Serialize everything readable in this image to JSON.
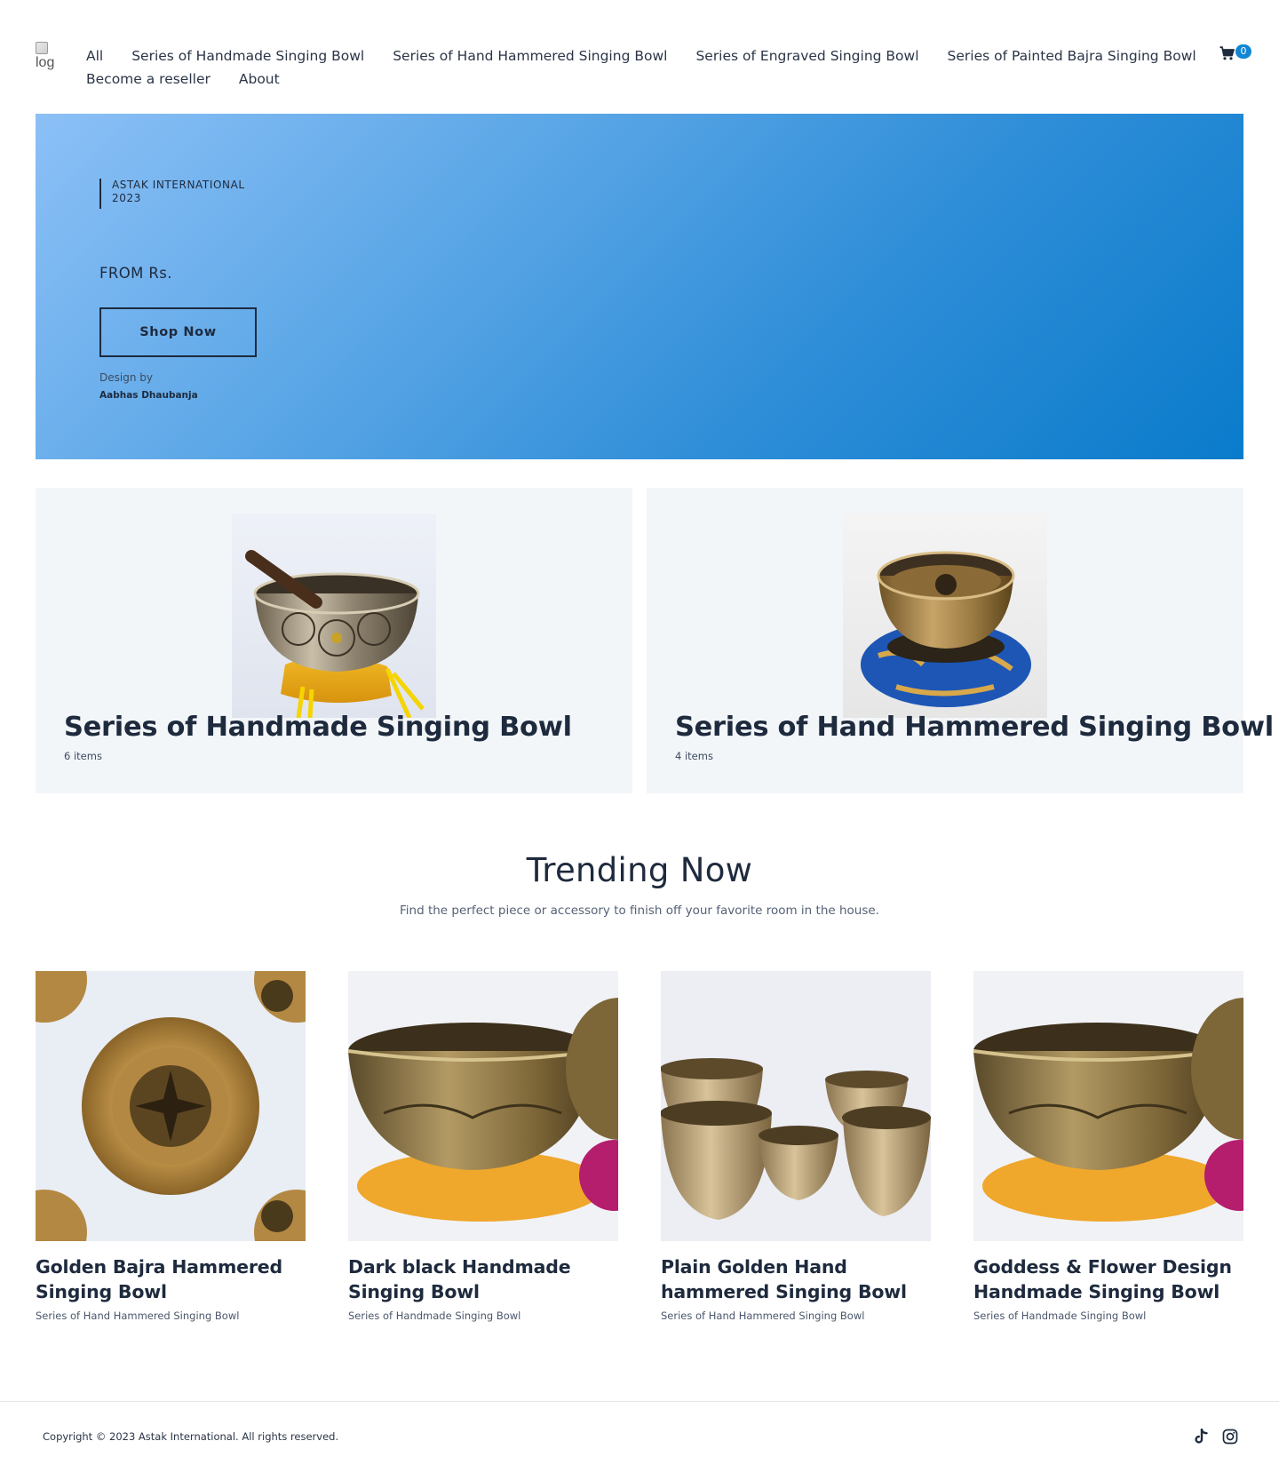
{
  "header": {
    "logo_alt": "log",
    "nav_row1": [
      "All",
      "Series of Handmade Singing Bowl",
      "Series of Hand Hammered Singing Bowl",
      "Series of Engraved Singing Bowl",
      "Series of Painted Bajra Singing Bowl"
    ],
    "nav_row2": [
      "Become a reseller",
      "About"
    ],
    "cart": {
      "icon": "cart-icon",
      "count": "0",
      "badge_color": "#1186d4"
    }
  },
  "hero": {
    "brand_line1": "ASTAK INTERNATIONAL",
    "brand_line2": "2023",
    "price_label": "FROM Rs.",
    "cta_label": "Shop Now",
    "design_by_label": "Design by",
    "designer_name": "Aabhas Dhaubanja",
    "gradient_start": "#8cc0f7",
    "gradient_end": "#0a7bcb"
  },
  "collections": [
    {
      "title": "Series of Handmade Singing Bowl",
      "count": "6 items"
    },
    {
      "title": "Series of Hand Hammered Singing Bowl",
      "count": "4 items"
    }
  ],
  "trending": {
    "title": "Trending Now",
    "subtitle": "Find the perfect piece or accessory to finish off your favorite room in the house.",
    "products": [
      {
        "name": "Golden Bajra Hammered Singing Bowl",
        "series": "Series of Hand Hammered Singing Bowl"
      },
      {
        "name": "Dark black Handmade Singing Bowl",
        "series": "Series of Handmade Singing Bowl"
      },
      {
        "name": "Plain Golden Hand hammered Singing Bowl",
        "series": "Series of Hand Hammered Singing Bowl"
      },
      {
        "name": "Goddess & Flower Design Handmade Singing Bowl",
        "series": "Series of Handmade Singing Bowl"
      }
    ]
  },
  "footer": {
    "copyright": "Copyright © 2023 Astak International. All rights reserved.",
    "social_icons": [
      "tiktok-icon",
      "instagram-icon"
    ]
  },
  "colors": {
    "text_primary": "#1e2a3d",
    "card_bg": "#f3f6f9",
    "accent": "#1186d4"
  }
}
